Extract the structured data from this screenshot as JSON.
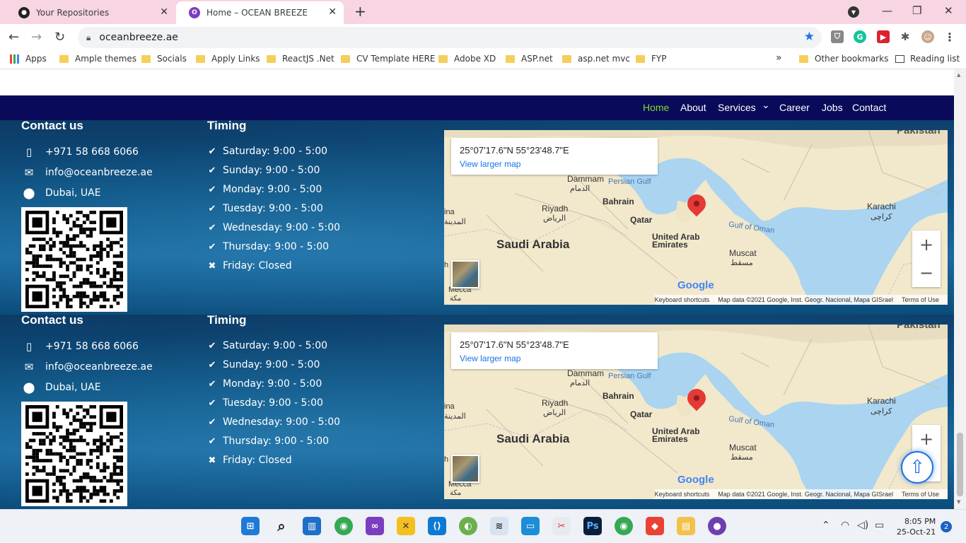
{
  "browser": {
    "tabs": [
      {
        "title": "Your Repositories",
        "active": false
      },
      {
        "title": "Home – OCEAN BREEZE",
        "active": true
      }
    ],
    "new_tab": "+",
    "url": "oceanbreeze.ae",
    "bookmarks": [
      "Apps",
      "Ample themes",
      "Socials",
      "Apply Links",
      "ReactJS .Net",
      "CV Template HERE",
      "Adobe XD",
      "ASP.net",
      "asp.net mvc",
      "FYP"
    ],
    "more_bookmarks": "»",
    "other_bookmarks": "Other bookmarks",
    "reading_list": "Reading list"
  },
  "navbar": {
    "items": [
      "Home",
      "About",
      "Services",
      "Career",
      "Jobs",
      "Contact"
    ],
    "services_caret": "⌄",
    "active_color": "#7cd92f",
    "background": "#0a0a5a"
  },
  "footer": {
    "contact_heading": "Contact us",
    "timing_heading": "Timing",
    "phone": "+971 58 668 6066",
    "email": "info@oceanbreeze.ae",
    "location": "Dubai, UAE",
    "timing": [
      {
        "icon": "check",
        "text": "Saturday: 9:00 - 5:00"
      },
      {
        "icon": "check",
        "text": "Sunday: 9:00 - 5:00"
      },
      {
        "icon": "check",
        "text": "Monday: 9:00 - 5:00"
      },
      {
        "icon": "check",
        "text": "Tuesday: 9:00 - 5:00"
      },
      {
        "icon": "check",
        "text": "Wednesday: 9:00 - 5:00"
      },
      {
        "icon": "check",
        "text": "Thursday: 9:00 - 5:00"
      },
      {
        "icon": "cross",
        "text": "Friday: Closed"
      }
    ]
  },
  "map": {
    "coordinates": "25°07'17.6\"N 55°23'48.7\"E",
    "view_larger": "View larger map",
    "labels": {
      "pakistan": "Pakistan",
      "dammam": "Dammam",
      "dammam_ar": "الدمام",
      "persian_gulf": "Persian Gulf",
      "bahrain": "Bahrain",
      "riyadh": "Riyadh",
      "riyadh_ar": "الرياض",
      "qatar": "Qatar",
      "medina": "ina",
      "medina_ar": "المدينة",
      "saudi": "Saudi Arabia",
      "uae": "United Arab\nEmirates",
      "muscat": "Muscat",
      "muscat_ar": "مسقط",
      "gulf_oman": "Gulf of Oman",
      "karachi": "Karachi",
      "karachi_ar": "کراچی",
      "mecca": "Mecca",
      "mecca_ar": "مكة",
      "h": "h"
    },
    "google": "Google",
    "keyboard": "Keyboard shortcuts",
    "map_data": "Map data ©2021 Google, Inst. Geogr. Nacional, Mapa GISrael",
    "terms": "Terms of Use",
    "zoom_in": "+",
    "zoom_out": "−"
  },
  "scroll_top": "⇧",
  "taskbar": {
    "time": "8:05 PM",
    "date": "25-Oct-21",
    "notifications": "2"
  }
}
